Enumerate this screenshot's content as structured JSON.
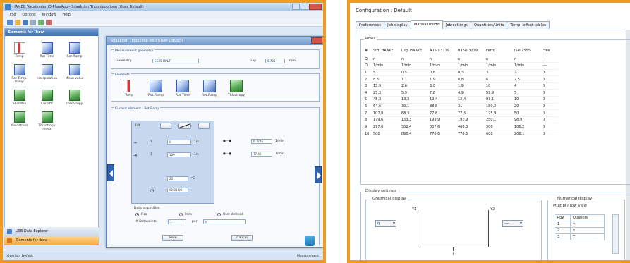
{
  "left_app": {
    "title": "HAMEG Vocalender IQ PhasApp - Sdaaktion Thoonioop loop (Ouer Default)",
    "menu": [
      "File",
      "Options",
      "Window",
      "Help"
    ],
    "sidebar": {
      "header": "Elements for Ibow",
      "items": [
        {
          "label": "Temp",
          "icon": "thermometer-icon",
          "style": "temp"
        },
        {
          "label": "Rot Time",
          "icon": "rot-time-icon",
          "style": "blue"
        },
        {
          "label": "Rot Ramp",
          "icon": "rot-ramp-icon",
          "style": "blue"
        },
        {
          "label": "Rot Temp. Ramp",
          "icon": "rot-temp-ramp-icon",
          "style": "blue"
        },
        {
          "label": "Interpolation",
          "icon": "interpolation-icon",
          "style": "blue"
        },
        {
          "label": "Mean value",
          "icon": "mean-value-icon",
          "style": "blue"
        },
        {
          "label": "ShotMax",
          "icon": "shot-max-icon",
          "style": "green"
        },
        {
          "label": "Cureffit",
          "icon": "curve-fit-icon",
          "style": "green"
        },
        {
          "label": "Thixotropy",
          "icon": "thixotropy-icon",
          "style": "green"
        },
        {
          "label": "Yieldstress",
          "icon": "yield-stress-icon",
          "style": "green"
        },
        {
          "label": "Thixotropy index",
          "icon": "thixotropy-index-icon",
          "style": "green"
        }
      ],
      "nav_tabs": [
        "USB Data Explorer",
        "Elements for Ibow"
      ]
    },
    "status_left": "Overlap: Default",
    "status_right": "Measurement",
    "dialog": {
      "title": "Sdaaktion Thoonioop loop (Ouer Default)",
      "measurement_group": "Measurement geometry",
      "geometry_label": "Geometry",
      "geometry_value": "CC25 DIN/Ti",
      "gap_label": "Gap",
      "gap_value": "0.700",
      "gap_unit": "mm",
      "elements_group": "Elements",
      "elements": [
        {
          "label": "Temp",
          "icon": "thermometer-icon",
          "style": "temp"
        },
        {
          "label": "Rot.Ramp",
          "icon": "rot-ramp-icon",
          "style": "blue"
        },
        {
          "label": "Rot Time",
          "icon": "rot-time-icon",
          "style": "blue"
        },
        {
          "label": "Rot.Ramp",
          "icon": "rot-ramp-icon",
          "style": "blue"
        },
        {
          "label": "Thixotropy",
          "icon": "thixotropy-icon",
          "style": "green"
        }
      ],
      "current_group": "Current element - Rot.Ramp",
      "panel_label": "1/4",
      "row1_value": "0",
      "row1_unit": "1/s",
      "row2_value": "100",
      "row2_unit": "1/s",
      "out1_value": "0.7746",
      "out1_unit": "1/min",
      "out2_value": "77.46",
      "out2_unit": "1/min",
      "temp_value": "20",
      "temp_unit": "°C",
      "time_value": "00:01:00",
      "acq_group": "Data acquisition",
      "acq_options": [
        "Rsa",
        "Intrv",
        "User defined"
      ],
      "datapoints_label": "# Datapoints",
      "datapoints_value": "1",
      "per_label": "per",
      "per_value": "s",
      "save_label": "Save",
      "cancel_label": "Cancel"
    }
  },
  "right_app": {
    "title": "Configuration : Default",
    "tabs": [
      "Preferences",
      "Job display",
      "Manual mode",
      "Job settings",
      "Quantities/Units",
      "Temp.-offset tables"
    ],
    "active_tab": 2,
    "rows_label": "Rows",
    "table": {
      "headers": [
        "#",
        "Std. HAAKE",
        "Leg. HAAKE",
        "A ISO 3219",
        "B ISO 3219",
        "Ferro",
        "ISO 2555",
        "Free"
      ],
      "rows": [
        [
          "Ω",
          "n",
          "n",
          "n",
          "n",
          "n",
          "n",
          "----"
        ],
        [
          "Ω",
          "1/min",
          "1/min",
          "1/min",
          "1/min",
          "1/min",
          "1/min",
          "----"
        ],
        [
          "1",
          "5",
          "0,5",
          "0,8",
          "0,3",
          "3",
          "2",
          "0"
        ],
        [
          "2",
          "8,3",
          "1,1",
          "1,9",
          "0,8",
          "6",
          "2,5",
          "0"
        ],
        [
          "3",
          "13,9",
          "2,6",
          "3,0",
          "1,9",
          "10",
          "4",
          "0"
        ],
        [
          "4",
          "25,3",
          "5,9",
          "7,8",
          "4,9",
          "59,9",
          "5",
          "0"
        ],
        [
          "5",
          "45,3",
          "13,3",
          "19,4",
          "12,4",
          "93,1",
          "10",
          "0"
        ],
        [
          "6",
          "64,6",
          "30,1",
          "38,8",
          "31",
          "180,2",
          "20",
          "0"
        ],
        [
          "7",
          "107,8",
          "68,3",
          "77,6",
          "77,6",
          "175,9",
          "50",
          "0"
        ],
        [
          "8",
          "179,6",
          "153,3",
          "193,9",
          "193,9",
          "250,1",
          "98,9",
          "0"
        ],
        [
          "9",
          "297,6",
          "352,4",
          "387,6",
          "468,3",
          "300",
          "106,2",
          "0"
        ],
        [
          "10",
          "500",
          "890,4",
          "776,6",
          "776,6",
          "600",
          "206,1",
          "0"
        ]
      ]
    },
    "display_label": "Display settings",
    "graph_label": "Graphical display",
    "left_combo": "η",
    "right_combo": "----",
    "axis_y1": "Y1",
    "axis_y2": "Y2",
    "axis_x": "t",
    "numerical_label": "Numerical display",
    "multiple_label": "Multiple row view",
    "mini_table": {
      "headers": [
        "Row",
        "Quantity"
      ],
      "rows": [
        [
          "1",
          "τ"
        ],
        [
          "2",
          "γ̇"
        ],
        [
          "3",
          "T"
        ]
      ]
    }
  },
  "colors": {
    "frame": "#f29a1e",
    "accent": "#2f62b3"
  }
}
